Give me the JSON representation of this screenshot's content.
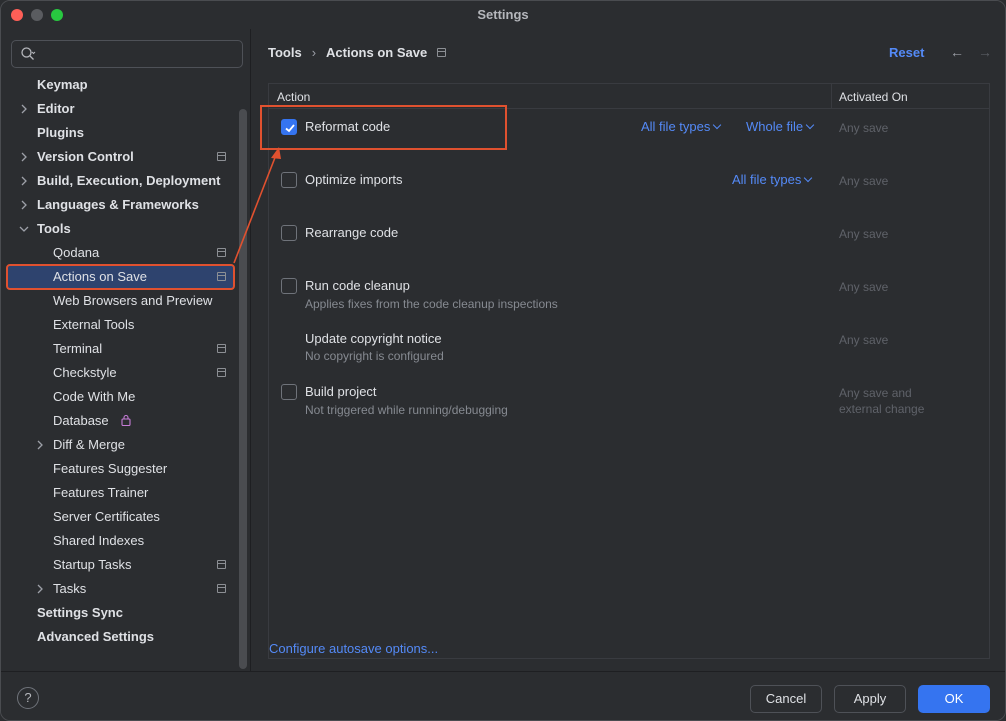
{
  "window": {
    "title": "Settings"
  },
  "search": {
    "placeholder": ""
  },
  "sidebar": {
    "items": [
      {
        "label": "Keymap"
      },
      {
        "label": "Editor"
      },
      {
        "label": "Plugins"
      },
      {
        "label": "Version Control"
      },
      {
        "label": "Build, Execution, Deployment"
      },
      {
        "label": "Languages & Frameworks"
      },
      {
        "label": "Tools"
      },
      {
        "label": "Qodana"
      },
      {
        "label": "Actions on Save"
      },
      {
        "label": "Web Browsers and Preview"
      },
      {
        "label": "External Tools"
      },
      {
        "label": "Terminal"
      },
      {
        "label": "Checkstyle"
      },
      {
        "label": "Code With Me"
      },
      {
        "label": "Database"
      },
      {
        "label": "Diff & Merge"
      },
      {
        "label": "Features Suggester"
      },
      {
        "label": "Features Trainer"
      },
      {
        "label": "Server Certificates"
      },
      {
        "label": "Shared Indexes"
      },
      {
        "label": "Startup Tasks"
      },
      {
        "label": "Tasks"
      },
      {
        "label": "Settings Sync"
      },
      {
        "label": "Advanced Settings"
      }
    ]
  },
  "header": {
    "breadcrumb_parent": "Tools",
    "breadcrumb_separator": "›",
    "breadcrumb_current": "Actions on Save",
    "reset_label": "Reset",
    "back_arrow": "←",
    "forward_arrow": "→"
  },
  "table": {
    "col_action": "Action",
    "col_activated": "Activated On",
    "rows": [
      {
        "name": "Reformat code",
        "desc": "",
        "checked": true,
        "file_types": "All file types",
        "scope": "Whole file",
        "activated": "Any save"
      },
      {
        "name": "Optimize imports",
        "desc": "",
        "checked": false,
        "file_types": "All file types",
        "activated": "Any save"
      },
      {
        "name": "Rearrange code",
        "desc": "",
        "checked": false,
        "activated": "Any save"
      },
      {
        "name": "Run code cleanup",
        "desc": "Applies fixes from the code cleanup inspections",
        "checked": false,
        "activated": "Any save"
      },
      {
        "name": "Update copyright notice",
        "desc": "No copyright is configured",
        "activated": "Any save"
      },
      {
        "name": "Build project",
        "desc": "Not triggered while running/debugging",
        "checked": false,
        "activated_line1": "Any save and",
        "activated_line2": "external change"
      }
    ]
  },
  "configure_link": "Configure autosave options...",
  "footer": {
    "help_label": "?",
    "cancel_label": "Cancel",
    "apply_label": "Apply",
    "ok_label": "OK"
  },
  "colors": {
    "accent": "#3574f0",
    "link": "#548af7",
    "annotation": "#e0512f",
    "background": "#2b2d30"
  }
}
